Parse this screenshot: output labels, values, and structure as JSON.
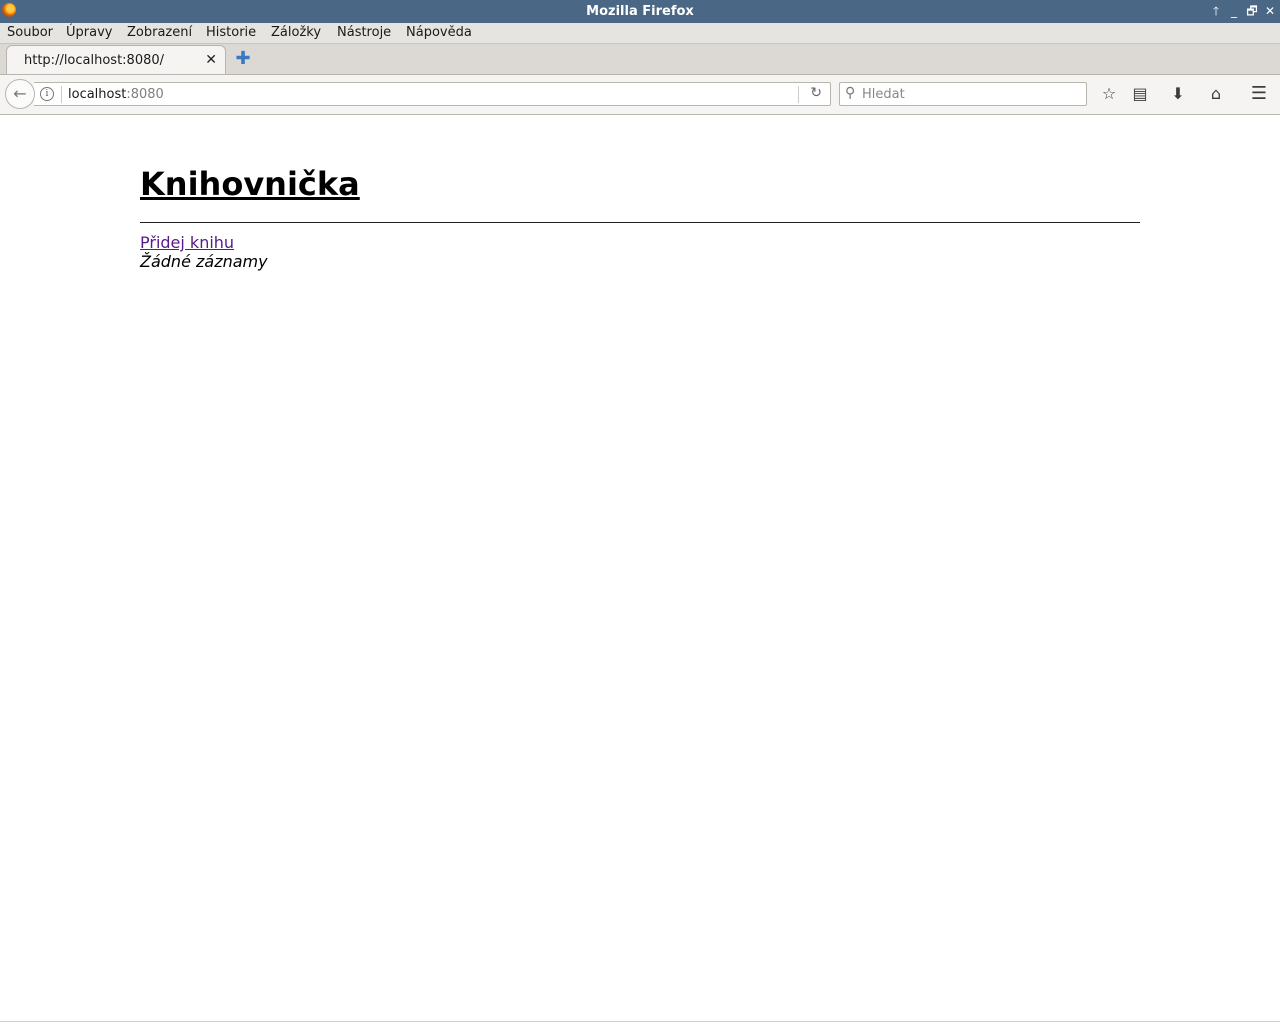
{
  "window": {
    "title": "Mozilla Firefox"
  },
  "menu": {
    "items": [
      "Soubor",
      "Úpravy",
      "Zobrazení",
      "Historie",
      "Záložky",
      "Nástroje",
      "Nápověda"
    ]
  },
  "tabs": [
    {
      "title": "http://localhost:8080/",
      "active": true
    }
  ],
  "navbar": {
    "url_host": "localhost",
    "url_port": ":8080",
    "search_placeholder": "Hledat"
  },
  "page": {
    "title": "Knihovnička",
    "add_link": "Přidej knihu",
    "empty_message": "Žádné záznamy"
  },
  "icons": {
    "back": "back-arrow-icon",
    "info": "info-icon",
    "reload": "reload-icon",
    "search": "magnifier-icon",
    "bookmark": "star-icon",
    "library": "clipboard-icon",
    "downloads": "download-arrow-icon",
    "home": "home-icon",
    "menu": "hamburger-icon"
  },
  "colors": {
    "titlebar": "#4a6886",
    "visited_link": "#551a8b"
  }
}
